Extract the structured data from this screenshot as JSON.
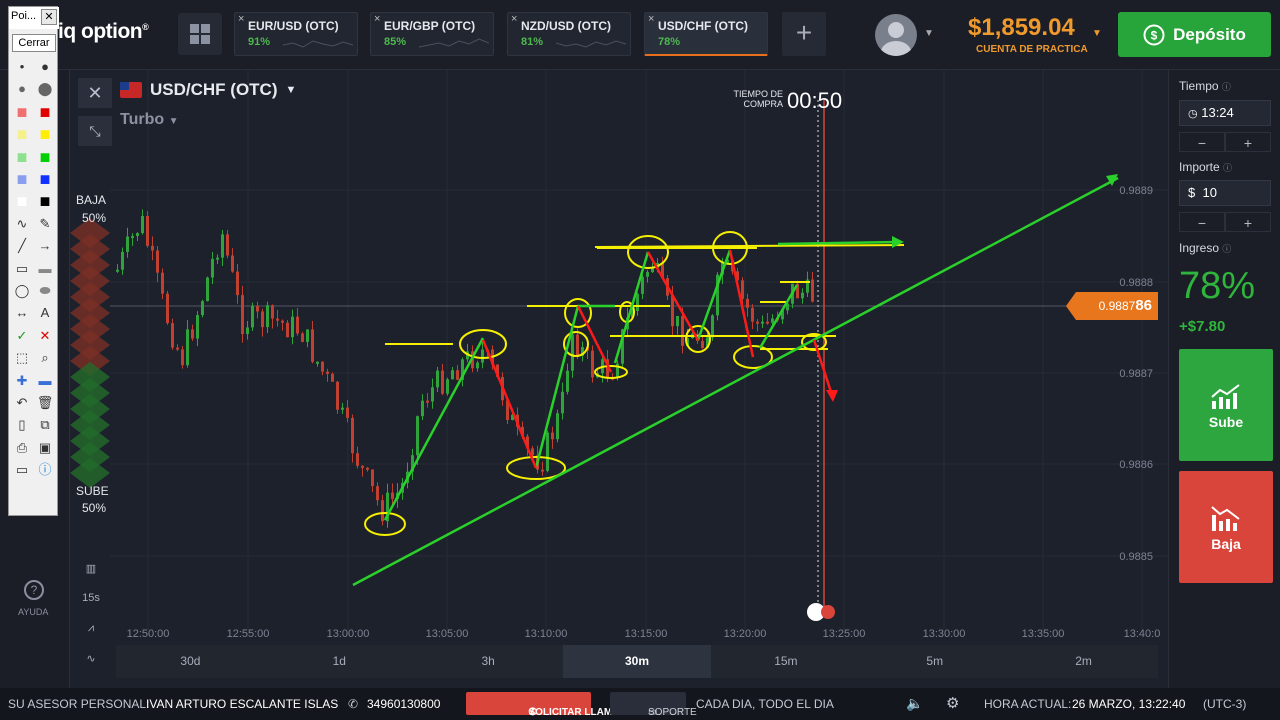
{
  "app": {
    "logo": "iq option",
    "logo_mark": "®"
  },
  "tabs": [
    {
      "name": "EUR/USD (OTC)",
      "pct": "91%",
      "active": false
    },
    {
      "name": "EUR/GBP (OTC)",
      "pct": "85%",
      "active": false
    },
    {
      "name": "NZD/USD (OTC)",
      "pct": "81%",
      "active": false
    },
    {
      "name": "USD/CHF (OTC)",
      "pct": "78%",
      "active": true
    }
  ],
  "tab_close": "×",
  "add_tab": "+",
  "account": {
    "balance": "$1,859.04",
    "type": "CUENTA DE PRACTICA"
  },
  "deposit_label": "Depósito",
  "paint": {
    "title": "Poi...",
    "close_label": "Cerrar"
  },
  "chart": {
    "pair": "USD/CHF (OTC)",
    "mode": "Turbo",
    "tiempo_label": "TIEMPO DE COMPRA",
    "tiempo_value": "00:50",
    "current_price_prefix": "0.9887",
    "current_price_suffix": "86",
    "baja_label": "BAJA",
    "baja_pct": "50%",
    "sube_label": "SUBE",
    "sube_pct": "50%",
    "interval": "15s",
    "y_ticks": [
      "0.9889",
      "0.9888",
      "0.9887",
      "0.9886",
      "0.9885"
    ],
    "x_ticks": [
      "12:50:00",
      "12:55:00",
      "13:00:00",
      "13:05:00",
      "13:10:00",
      "13:15:00",
      "13:20:00",
      "13:25:00",
      "13:30:00",
      "13:35:00",
      "13:40:0"
    ],
    "periods": [
      "30d",
      "1d",
      "3h",
      "30m",
      "15m",
      "5m",
      "2m"
    ],
    "active_period": "30m"
  },
  "sidebar": {
    "help_label": "AYUDA",
    "help_icon": "?"
  },
  "right_panel": {
    "tiempo_label": "Tiempo",
    "tiempo_value": "13:24",
    "importe_label": "Importe",
    "importe_currency": "$",
    "importe_value": "10",
    "ingreso_label": "Ingreso",
    "ingreso_pct": "78%",
    "ingreso_amount": "+$7.80",
    "sube_label": "Sube",
    "baja_label": "Baja",
    "minus": "−",
    "plus": "+"
  },
  "bottom_bar": {
    "advisor_label": "SU ASESOR PERSONAL:",
    "advisor_name": "IVAN ARTURO ESCALANTE ISLAS",
    "phone": "34960130800",
    "call_button": "SOLICITAR LLAMADA",
    "support_button": "SOPORTE",
    "hours": "CADA DIA, TODO EL DIA",
    "time_label": "HORA ACTUAL:",
    "time_value": "26 MARZO, 13:22:40",
    "timezone": "(UTC-3)"
  },
  "colors": {
    "green": "#2fb53c",
    "red": "#d9453a",
    "orange": "#e8761d",
    "annotation_yellow": "#f5f000",
    "annotation_green": "#2ad12a"
  }
}
